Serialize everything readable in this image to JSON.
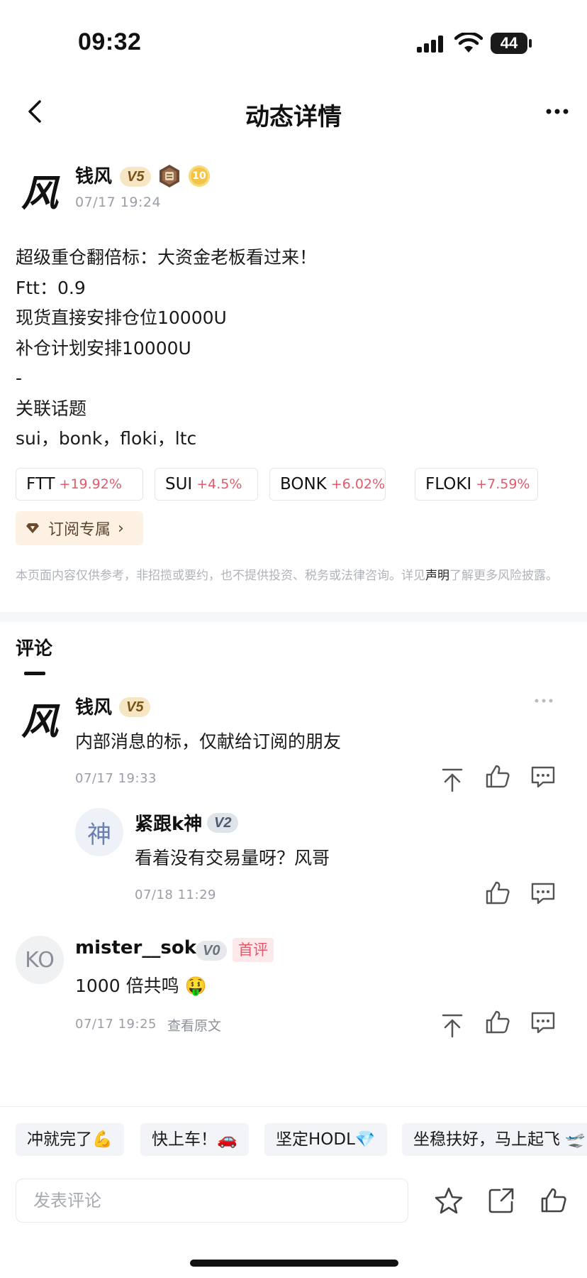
{
  "status_bar": {
    "time": "09:32",
    "battery": "44"
  },
  "nav": {
    "title": "动态详情"
  },
  "post": {
    "author": "钱风",
    "avatar_char": "风",
    "level": "V5",
    "medal_level": "10",
    "date": "07/17 19:24",
    "lines": [
      "超级重仓翻倍标：大资金老板看过来！",
      "Ftt：0.9",
      "现货直接安排仓位10000U",
      "补仓计划安排10000U",
      "-",
      "关联话题",
      "sui，bonk，floki，ltc"
    ],
    "tickers": [
      {
        "symbol": "FTT",
        "change": "+19.92%"
      },
      {
        "symbol": "SUI",
        "change": "+4.5%"
      },
      {
        "symbol": "BONK",
        "change": "+6.02%"
      },
      {
        "symbol": "FLOKI",
        "change": "+7.59%"
      }
    ],
    "subscribe_label": "订阅专属",
    "disclaimer_pre": "本页面内容仅供参考，非招揽或要约，也不提供投资、税务或法律咨询。详见",
    "disclaimer_link": "声明",
    "disclaimer_post": "了解更多风险披露。"
  },
  "comments_title": "评论",
  "comments": [
    {
      "author": "钱风",
      "avatar_char": "风",
      "level": "V5",
      "text": "内部消息的标，仅献给订阅的朋友",
      "date": "07/17 19:33"
    },
    {
      "author": "紧跟k神",
      "avatar_char": "神",
      "level": "V2",
      "text": "看着没有交易量呀？风哥",
      "date": "07/18 11:29"
    },
    {
      "author": "mister__soko",
      "avatar_char": "KO",
      "level": "V0",
      "tag": "首评",
      "text": "1000 倍共鸣 🤑",
      "date": "07/17 19:25",
      "view_original": "查看原文"
    }
  ],
  "quick_replies": [
    "冲就完了💪",
    "快上车！🚗",
    "坚定HODL💎",
    "坐稳扶好，马上起飞 🛫"
  ],
  "comment_input": {
    "placeholder": "发表评论"
  },
  "colors": {
    "up": "#e25a6c",
    "chip_border": "#e5e6ea",
    "subscribe_bg": "#fcf1e3",
    "accent_gold": "#f6e6c4"
  }
}
